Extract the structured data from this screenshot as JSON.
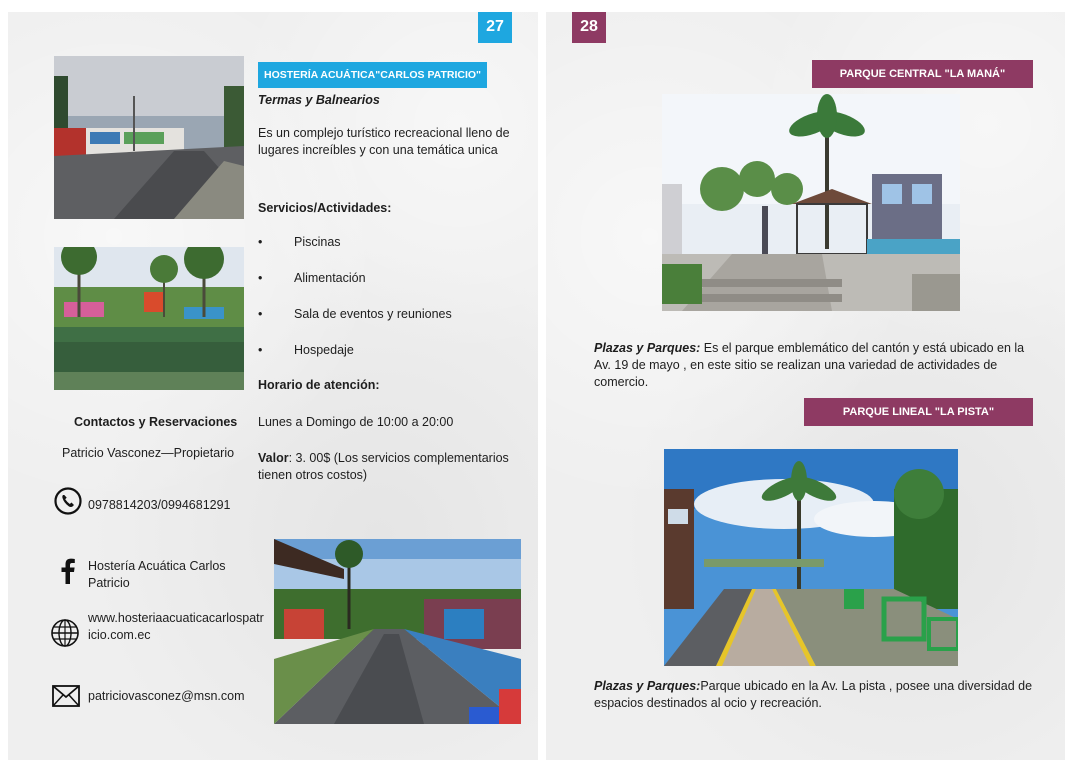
{
  "left_page": {
    "page_number": "27",
    "title_tag": "HOSTERÍA ACUÁTICA\"CARLOS PATRICIO\"",
    "category": "Termas y Balnearios",
    "description": "Es un  complejo turístico recreacional lleno de lugares increíbles y con una temática unica",
    "services_heading": "Servicios/Actividades:",
    "services": [
      "Piscinas",
      "Alimentación",
      "Sala de eventos y reuniones",
      "Hospedaje"
    ],
    "hours_heading": "Horario de atención:",
    "hours": "Lunes a Domingo de 10:00 a 20:00",
    "price_label": "Valor",
    "price_text": ": 3. 00$ (Los servicios complementarios tienen otros costos)",
    "contacts_heading": "Contactos y Reservaciones",
    "contact_person": "Patricio Vasconez—Propietario",
    "phone": "0978814203/0994681291",
    "facebook": "Hostería Acuática Carlos Patricio",
    "website": "www.hosteriaacuaticacarlospatricio.com.ec",
    "email": "patriciovasconez@msn.com",
    "icons": {
      "phone": "phone-icon",
      "facebook": "facebook-icon",
      "web": "globe-icon",
      "email": "envelope-icon"
    }
  },
  "right_page": {
    "page_number": "28",
    "park1_tag": "PARQUE CENTRAL \"LA MANÁ\"",
    "park1_category": "Plazas y Parques:",
    "park1_text": " Es el parque emblemático del cantón y está  ubicado en la Av. 19 de mayo , en este sitio se realizan una variedad de actividades de comercio.",
    "park2_tag": "PARQUE LINEAL \"LA PISTA\"",
    "park2_category": "Plazas y Parques:",
    "park2_text": "Parque ubicado en la Av. La pista , posee una diversidad de espacios destinados al ocio y recreación."
  },
  "colors": {
    "blue_accent": "#1ea7e0",
    "magenta_accent": "#8e3a63",
    "page_bg": "#efefef"
  }
}
